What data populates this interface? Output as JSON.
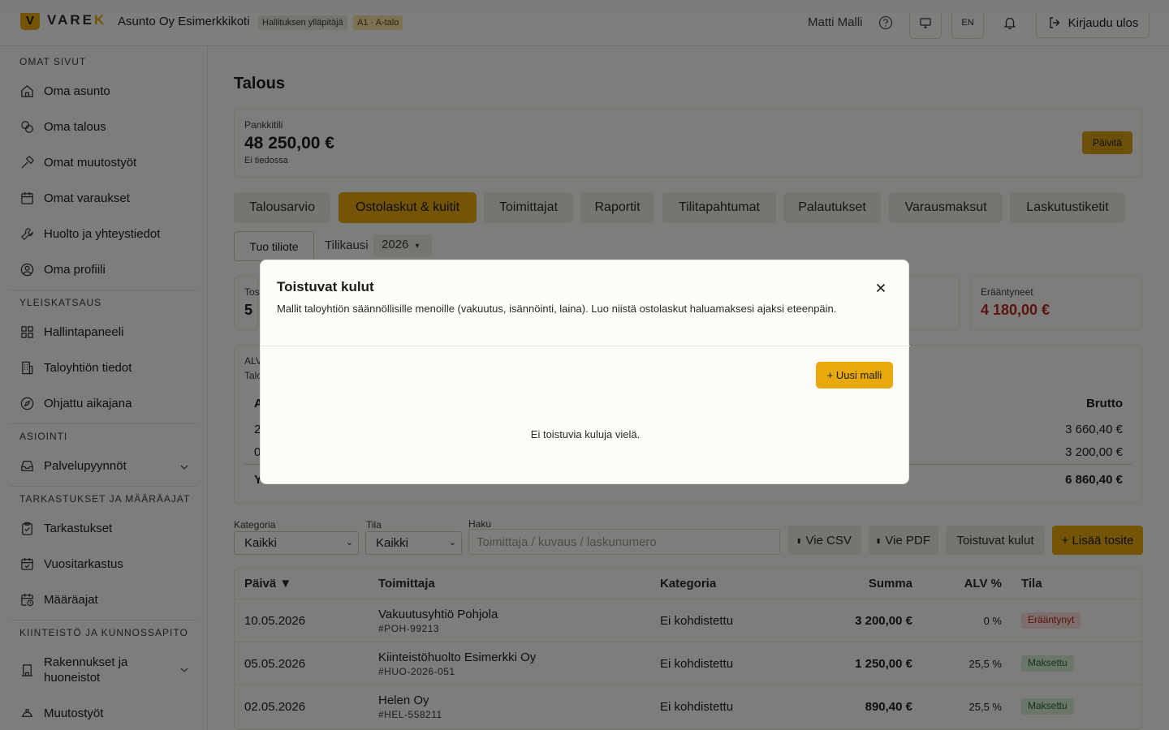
{
  "brand": {
    "mark": "V",
    "name_main": "VARE",
    "name_accent": "K"
  },
  "header": {
    "org_name": "Asunto Oy Esimerkkikoti",
    "role_badge": "Hallituksen ylläpitäjä",
    "apartment_badge": "A1 · A-talo",
    "user_name": "Matti Malli",
    "language": "EN",
    "logout_label": "Kirjaudu ulos"
  },
  "sidebar": {
    "sections": [
      {
        "title": "OMAT SIVUT",
        "items": [
          {
            "label": "Oma asunto",
            "icon": "home-icon"
          },
          {
            "label": "Oma talous",
            "icon": "coins-icon"
          },
          {
            "label": "Omat muutostyöt",
            "icon": "hammer-icon"
          },
          {
            "label": "Omat varaukset",
            "icon": "calendar-icon"
          },
          {
            "label": "Huolto ja yhteystiedot",
            "icon": "wrench-icon"
          },
          {
            "label": "Oma profiili",
            "icon": "user-circle-icon"
          }
        ]
      },
      {
        "title": "YLEISKATSAUS",
        "items": [
          {
            "label": "Hallintapaneeli",
            "icon": "dashboard-icon"
          },
          {
            "label": "Taloyhtiön tiedot",
            "icon": "building-icon"
          },
          {
            "label": "Ohjattu aikajana",
            "icon": "compass-icon"
          }
        ]
      },
      {
        "title": "ASIOINTI",
        "items": [
          {
            "label": "Palvelupyynnöt",
            "icon": "inbox-icon"
          }
        ]
      },
      {
        "title": "TARKASTUKSET JA MÄÄRÄAJAT",
        "items": [
          {
            "label": "Tarkastukset",
            "icon": "clipboard-check-icon"
          },
          {
            "label": "Vuositarkastus",
            "icon": "calendar-check-icon"
          },
          {
            "label": "Määräajat",
            "icon": "calendar-clock-icon"
          }
        ]
      },
      {
        "title": "KIINTEISTÖ JA KUNNOSSAPITO",
        "items": [
          {
            "label": "Rakennukset ja huoneistot",
            "icon": "building-columns-icon"
          },
          {
            "label": "Muutostyöt",
            "icon": "helmet-icon"
          }
        ]
      }
    ]
  },
  "main": {
    "title": "Talous",
    "bank": {
      "label": "Pankkitili",
      "amount": "48 250,00 €",
      "status": "Ei tiedossa",
      "update_label": "Päivitä"
    },
    "tabs": [
      "Talousarvio",
      "Ostolaskut & kuitit",
      "Toimittajat",
      "Raportit",
      "Tilitapahtumat",
      "Palautukset",
      "Varausmaksut",
      "Laskutustiketit"
    ],
    "active_tab": "Ostolaskut & kuitit",
    "import_label": "Tuo tiliote",
    "fiscal_label": "Tilikausi",
    "fiscal_value": "2026",
    "stats": [
      {
        "label": "Tos",
        "value": "5"
      },
      {
        "label": "Erääntyneet",
        "value": "4 180,00 €"
      }
    ],
    "vat": {
      "header_a": "ALV",
      "header_b": "Talo",
      "col_left": "A",
      "col_brutto": "Brutto",
      "rows": [
        {
          "left": "2",
          "brutto": "3 660,40 €"
        },
        {
          "left": "0",
          "brutto": "3 200,00 €"
        }
      ],
      "total_left": "Y",
      "total_brutto": "6 860,40 €"
    },
    "filters": {
      "category_label": "Kategoria",
      "category_value": "Kaikki",
      "state_label": "Tila",
      "state_value": "Kaikki",
      "search_label": "Haku",
      "search_placeholder": "Toimittaja / kuvaus / laskunumero",
      "csv_label": "Vie CSV",
      "pdf_label": "Vie PDF",
      "recurring_label": "Toistuvat kulut",
      "add_label": "+ Lisää tosite"
    },
    "table": {
      "headers": {
        "date": "Päivä ▼",
        "supplier": "Toimittaja",
        "category": "Kategoria",
        "sum": "Summa",
        "vat": "ALV %",
        "state": "Tila"
      },
      "rows": [
        {
          "date": "10.05.2026",
          "supplier": "Vakuutusyhtiö Pohjola",
          "ref": "#POH-99213",
          "category": "Ei kohdistettu",
          "sum": "3 200,00 €",
          "vat": "0 %",
          "state": "Erääntynyt",
          "state_kind": "due"
        },
        {
          "date": "05.05.2026",
          "supplier": "Kiinteistöhuolto Esimerkki Oy",
          "ref": "#HUO-2026-051",
          "category": "Ei kohdistettu",
          "sum": "1 250,00 €",
          "vat": "25,5 %",
          "state": "Maksettu",
          "state_kind": "paid"
        },
        {
          "date": "02.05.2026",
          "supplier": "Helen Oy",
          "ref": "#HEL-558211",
          "category": "Ei kohdistettu",
          "sum": "890,40 €",
          "vat": "25,5 %",
          "state": "Maksettu",
          "state_kind": "paid"
        }
      ]
    }
  },
  "modal": {
    "title": "Toistuvat kulut",
    "description": "Mallit taloyhtiön säännöllisille menoille (vakuutus, isännöinti, laina). Luo niistä ostolaskut haluamaksesi ajaksi eteenpäin.",
    "new_label": "+ Uusi malli",
    "empty_text": "Ei toistuvia kuluja vielä."
  },
  "colors": {
    "accent": "#e8a90c",
    "danger": "#b32a1f",
    "success": "#246b2a"
  }
}
